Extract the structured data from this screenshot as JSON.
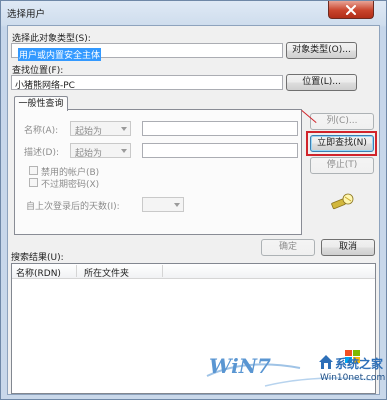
{
  "window": {
    "title": "选择用户"
  },
  "object_type": {
    "label": "选择此对象类型(S):",
    "value": "用户或内置安全主体",
    "button": "对象类型(O)..."
  },
  "location": {
    "label": "查找位置(F):",
    "value": "小猪熊网络-PC",
    "button": "位置(L)..."
  },
  "tab": {
    "label": "一般性查询"
  },
  "query": {
    "name_label": "名称(A):",
    "name_mode": "起始为",
    "desc_label": "描述(D):",
    "desc_mode": "起始为",
    "disabled_accounts": "禁用的帐户(B)",
    "no_expire_pwd": "不过期密码(X)",
    "days_label": "自上次登录后的天数(I):"
  },
  "buttons": {
    "columns": "列(C)...",
    "find_now": "立即查找(N)",
    "stop": "停止(T)",
    "ok": "确定",
    "cancel": "取消"
  },
  "results": {
    "label": "搜索结果(U):",
    "columns": [
      "名称(RDN)",
      "所在文件夹"
    ]
  },
  "watermark": {
    "brand": "WiN7",
    "site_cn": "系统之家",
    "site_url": "Win10net.com"
  },
  "colors": {
    "highlight_box": "#d1242b",
    "selection": "#3399ff",
    "close_button": "#c9442c"
  }
}
